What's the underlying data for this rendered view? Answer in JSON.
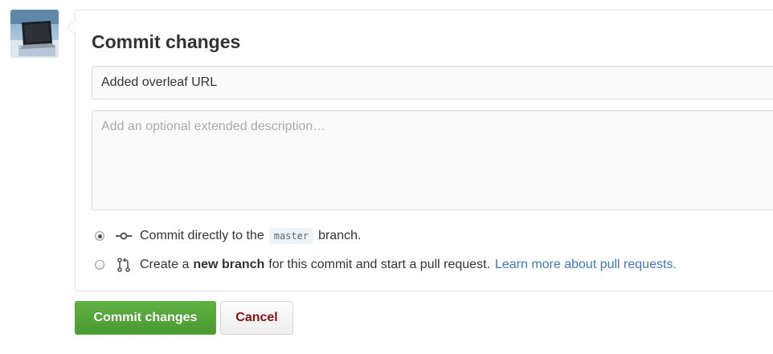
{
  "form": {
    "title": "Commit changes",
    "summary_value": "Added overleaf URL",
    "description_placeholder": "Add an optional extended description…"
  },
  "options": {
    "direct": {
      "selected": true,
      "icon": "commit-icon",
      "text_before": "Commit directly to the",
      "branch": "master",
      "text_after": "branch."
    },
    "new_branch": {
      "selected": false,
      "icon": "pull-request-icon",
      "text_before": "Create a",
      "bold": "new branch",
      "text_after": "for this commit and start a pull request.",
      "link": "Learn more about pull requests."
    }
  },
  "buttons": {
    "commit": "Commit changes",
    "cancel": "Cancel"
  },
  "colors": {
    "primary_green": "#5ca941",
    "cancel_text": "#8b1010",
    "link": "#4078c0"
  }
}
